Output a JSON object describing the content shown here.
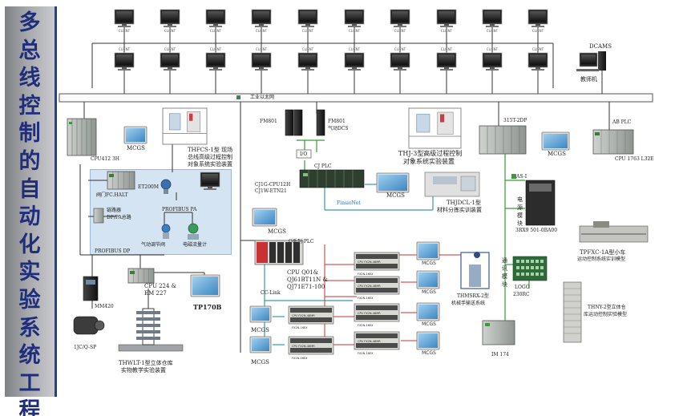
{
  "sidebar_title": "多总线控制的自动化实验系统工程",
  "sidebar_chars": [
    "多",
    "总",
    "线",
    "控",
    "制",
    "的",
    "自",
    "动",
    "化",
    "实",
    "验",
    "系",
    "统",
    "工",
    "程"
  ],
  "workstations": {
    "client_label": "CLIENT",
    "dcams_label": "DCAMS",
    "teacher_pc_label": "教师机"
  },
  "network": {
    "ethernet_label": "工业以太网"
  },
  "left_area": {
    "cpu412": "CPU412 3H",
    "mcgs": "MCGS",
    "thfcs_line1": "THFCS-1型 现场",
    "thfcs_line2": "总线高级过程控制",
    "thfcs_line3": "对象系统实验装置",
    "et200m": "ET200M",
    "et200m_sub": "阀门FC.HALT",
    "link_line1": "链路器",
    "link_line2": "DP/PA总路",
    "profibus_pa": "PROFIBUS PA",
    "valve": "气动调节阀",
    "em_flow": "电磁流量计",
    "profibus_dp": "PROFIBUS DP",
    "mm420": "MM420",
    "motor": "1JC/Q-SP",
    "cpu224_line1": "CPU 224 &",
    "cpu224_line2": "EM 227",
    "tp170b": "TP170B",
    "thwlt_line1": "THWLT-1型立体仓库",
    "thwlt_line2": "实物教学实验装置"
  },
  "center_area": {
    "fm801_a": "FM801",
    "fm801_b": "FM801",
    "dcs": "气动DCS",
    "io": "I/O",
    "cj_line1": "CJ1G-CPU12H",
    "cj_line2": "CJ1W-ETN21",
    "cj_plc": "CJ PLC",
    "fins": "FinsioNet",
    "mcgs_cj": "MCGS",
    "thj_line1": "THJ-3型高级过程控制",
    "thj_line2": "对象系统实验装置",
    "thjdcl_line1": "THJDCL-1型",
    "thjdcl_line2": "材料分拣实训装置",
    "mcgs_q": "MCGS",
    "q_plc": "Q系列 PLC",
    "cpu_q_line1": "CPU Q01&",
    "cpu_q_line2": "QJ61BT11N &",
    "cpu_q_line3": "QJ71E71-100",
    "cc_link": "CC-Link",
    "fx_label": "CPU FX2N-48MR",
    "fx_sub": "FX2N-16EX",
    "mcgs_fx": "MCGS",
    "mcgs_bottom": "MCGS",
    "thmsrx_line1": "THMSRX-2型",
    "thmsrx_line2": "机械手输送系统"
  },
  "right_area": {
    "s7_315": "315T-2DP",
    "mcgs_right": "MCGS",
    "ab_plc": "AB PLC",
    "cpu1763": "CPU 1763  L32E",
    "as_i": "AS-I",
    "as_i_module_line1": "电",
    "as_i_module_line2": "源",
    "as_i_module_line3": "模",
    "as_i_module_line4": "块",
    "part_no": "3RX9 501-0BA00",
    "tpfxc_line1": "TPFXC-1A型小车",
    "tpfxc_line2": "运动控制系统实训模型",
    "comm_line1": "通",
    "comm_line2": "讯",
    "comm_line3": "模",
    "comm_line4": "块",
    "logo": "LOGO",
    "logo_sub": "230RC",
    "thny_line1": "THNY-2型立体仓",
    "thny_line2": "库运动控制实验模型",
    "im174": "IM 174"
  }
}
